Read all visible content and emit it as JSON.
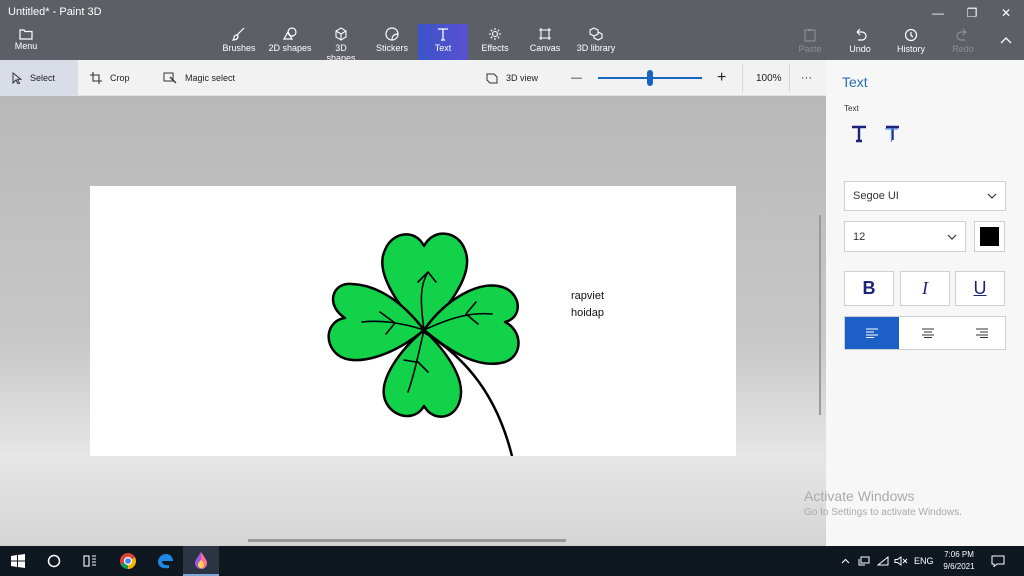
{
  "window": {
    "title": "Untitled* - Paint 3D",
    "minimize_glyph": "—",
    "maximize_glyph": "❐",
    "close_glyph": "✕"
  },
  "ribbon": {
    "menu_label": "Menu",
    "tools": [
      {
        "label": "Brushes",
        "icon": "brush-icon"
      },
      {
        "label": "2D shapes",
        "icon": "2d-shapes-icon"
      },
      {
        "label": "3D shapes",
        "icon": "3d-shapes-icon"
      },
      {
        "label": "Stickers",
        "icon": "stickers-icon"
      },
      {
        "label": "Text",
        "icon": "text-icon",
        "active": true
      },
      {
        "label": "Effects",
        "icon": "effects-icon"
      },
      {
        "label": "Canvas",
        "icon": "canvas-icon"
      },
      {
        "label": "3D library",
        "icon": "3d-library-icon"
      }
    ],
    "right_tools": [
      {
        "label": "Paste",
        "icon": "paste-icon",
        "enabled": false
      },
      {
        "label": "Undo",
        "icon": "undo-icon",
        "enabled": true
      },
      {
        "label": "History",
        "icon": "history-icon",
        "enabled": true
      },
      {
        "label": "Redo",
        "icon": "redo-icon",
        "enabled": false
      }
    ]
  },
  "toolbar2": {
    "select_label": "Select",
    "crop_label": "Crop",
    "magic_select_label": "Magic select",
    "view3d_label": "3D view",
    "zoom_minus": "—",
    "zoom_plus": "+",
    "zoom_level": "100%",
    "zoom_fraction": 0.5,
    "more_glyph": "···"
  },
  "canvas": {
    "text_line1": "rapviet",
    "text_line2": "hoidap",
    "drawing": "four-leaf-clover"
  },
  "panel": {
    "title": "Text",
    "subtitle": "Text",
    "font_family": "Segoe UI",
    "font_size": "12",
    "text_color": "#000000",
    "bold_label": "B",
    "italic_label": "I",
    "underline_label": "U",
    "align_active": "left"
  },
  "watermark": {
    "line1": "Activate Windows",
    "line2": "Go to Settings to activate Windows."
  },
  "taskbar": {
    "language": "ENG",
    "time": "7:06 PM",
    "date": "9/6/2021"
  },
  "colors": {
    "accent": "#1b5fc7",
    "clover_green": "#12d24a",
    "titlebar": "#5c6066"
  }
}
